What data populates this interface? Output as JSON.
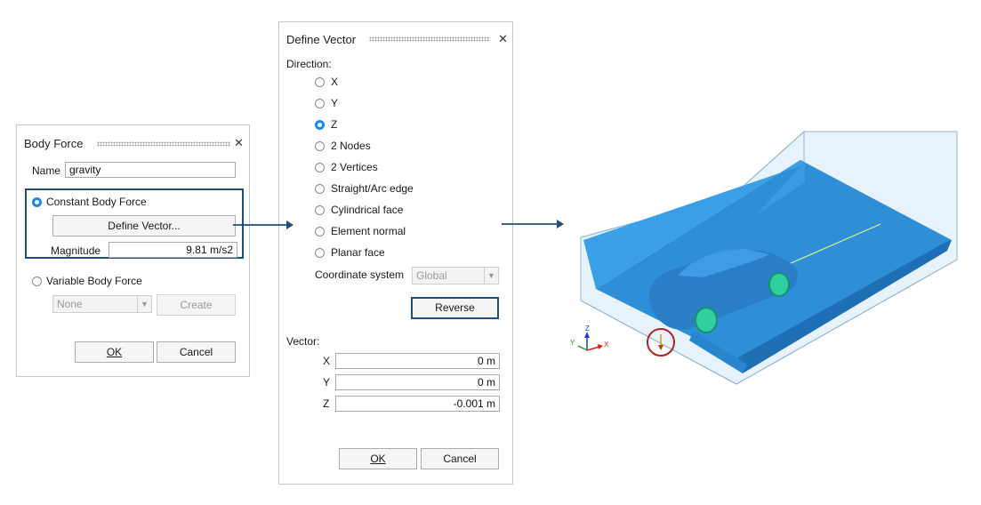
{
  "body_force": {
    "title": "Body Force",
    "name_label": "Name",
    "name_value": "gravity",
    "constant_label": "Constant Body Force",
    "define_vector_label": "Define Vector...",
    "magnitude_label": "Magnitude",
    "magnitude_value": "9.81 m/s2",
    "variable_label": "Variable Body Force",
    "variable_select": "None",
    "create_label": "Create",
    "ok_label": "OK",
    "cancel_label": "Cancel"
  },
  "define_vector": {
    "title": "Define Vector",
    "direction_label": "Direction:",
    "options": [
      "X",
      "Y",
      "Z",
      "2 Nodes",
      "2 Vertices",
      "Straight/Arc edge",
      "Cylindrical face",
      "Element normal",
      "Planar face"
    ],
    "selected_option": "Z",
    "coord_label": "Coordinate system",
    "coord_value": "Global",
    "reverse_label": "Reverse",
    "vector_label": "Vector:",
    "x_label": "X",
    "x_value": "0 m",
    "y_label": "Y",
    "y_value": "0 m",
    "z_label": "Z",
    "z_value": "-0.001 m",
    "ok_label": "OK",
    "cancel_label": "Cancel"
  },
  "triad": {
    "x_label": "X",
    "y_label": "Y",
    "z_label": "Z"
  },
  "colors": {
    "accent_blue": "#1e88e5",
    "focus_border": "#1f4e79",
    "arrow": "#1f4e79",
    "highlight_circle": "#b22222",
    "model_blue": "#2e8fd6",
    "wheel_green": "#2fcf9f"
  }
}
